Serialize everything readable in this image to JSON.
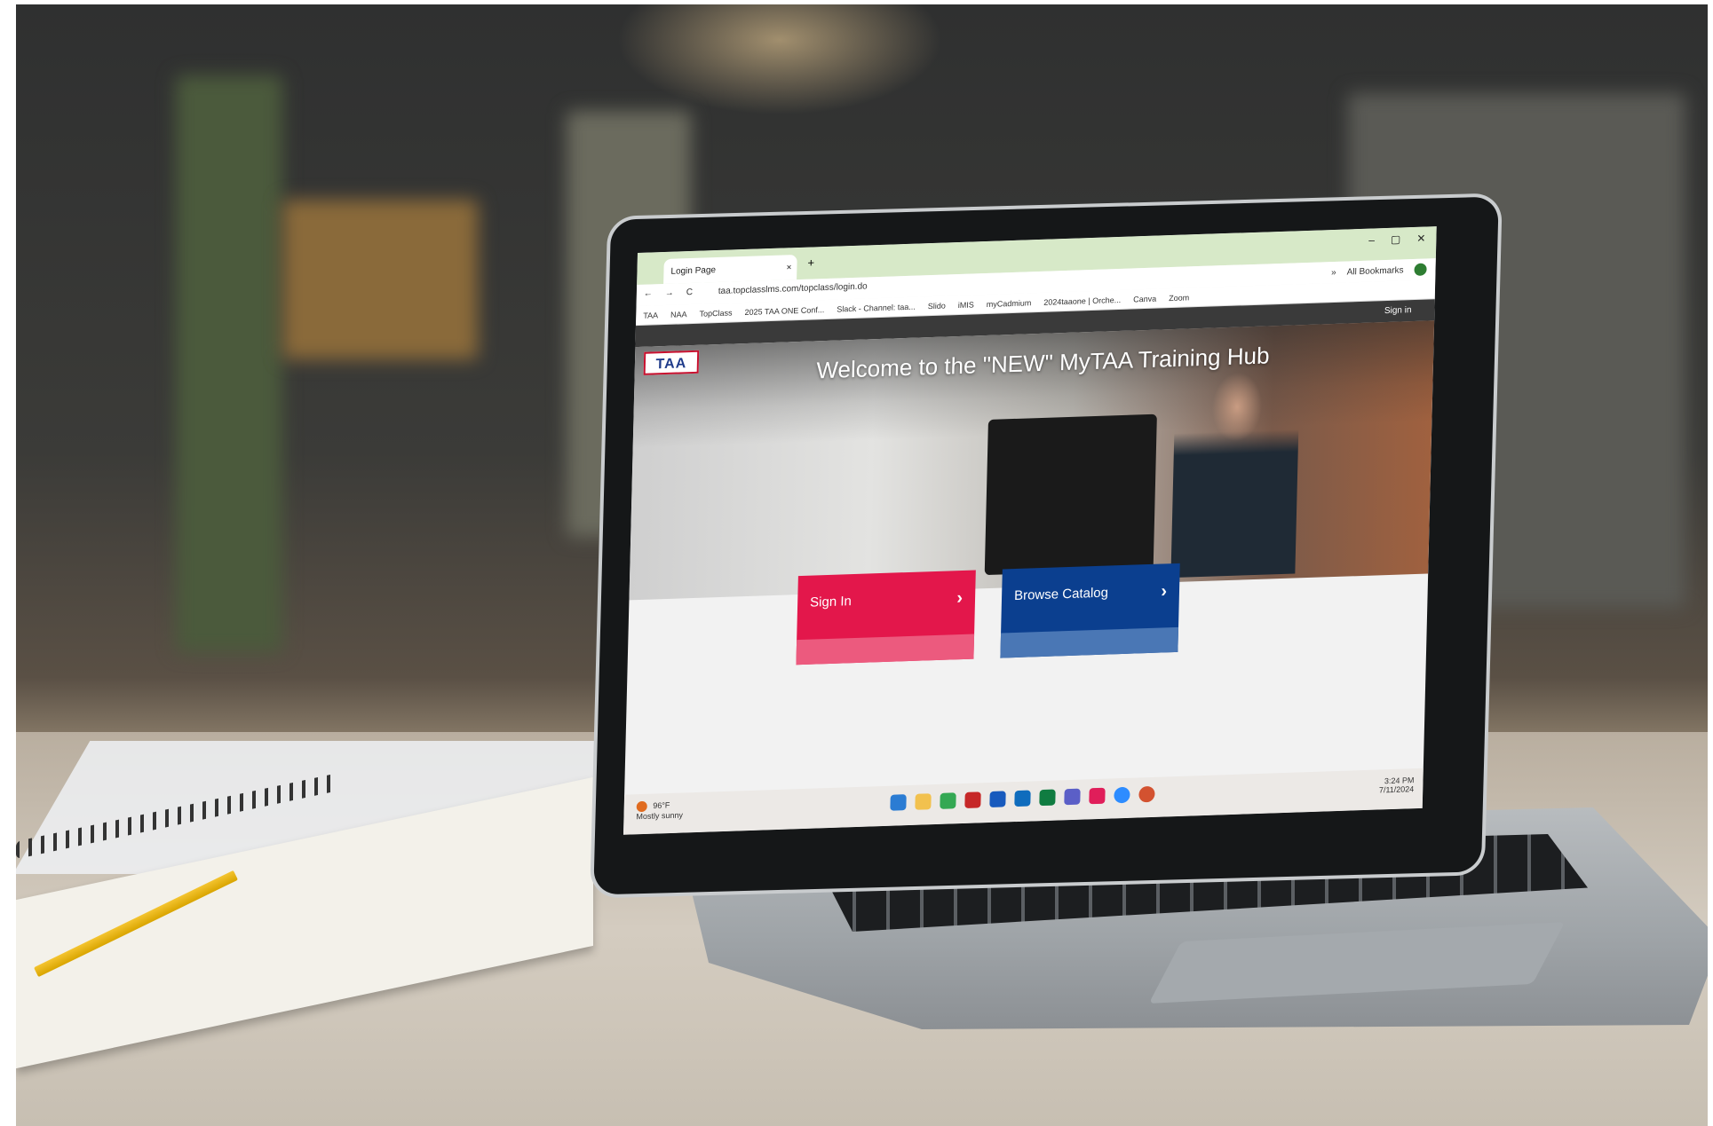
{
  "browser": {
    "tab_title": "Login Page",
    "tab_close": "×",
    "new_tab": "+",
    "window_controls": [
      "–",
      "▢",
      "✕"
    ],
    "url": "taa.topclasslms.com/topclass/login.do",
    "nav": [
      "←",
      "→",
      "C"
    ],
    "more": "»",
    "all_bookmarks": "All Bookmarks",
    "bookmarks": [
      "TAA",
      "NAA",
      "TopClass",
      "2025 TAA ONE Conf...",
      "Slack - Channel: taa...",
      "Slido",
      "iMIS",
      "myCadmium",
      "2024taaone | Orche...",
      "Canva",
      "Zoom"
    ]
  },
  "site": {
    "header_signin": "Sign in",
    "logo_text": "TAA",
    "hero_title": "Welcome to the \"NEW\" MyTAA Training Hub",
    "signin_label": "Sign In",
    "browse_label": "Browse Catalog",
    "chevron": "›"
  },
  "taskbar": {
    "temperature": "96°F",
    "condition": "Mostly sunny",
    "time": "3:24 PM",
    "date": "7/11/2024"
  },
  "colors": {
    "signin": "#e3174b",
    "browse": "#0b3f8f",
    "tabbar": "#d7e9c8"
  }
}
